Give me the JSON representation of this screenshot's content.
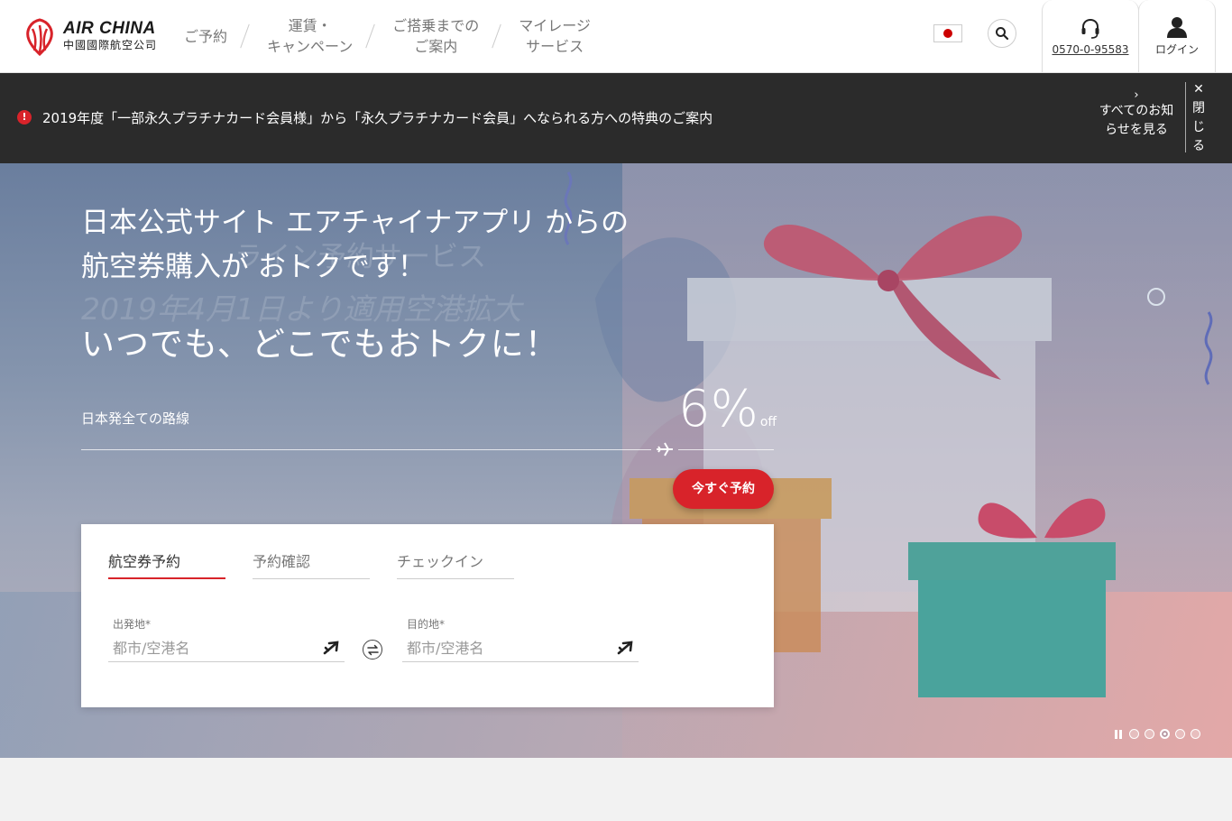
{
  "header": {
    "logo_en": "AIR CHINA",
    "logo_cn": "中國國際航空公司",
    "nav": [
      {
        "line1": "ご予約",
        "line2": ""
      },
      {
        "line1": "運賃・",
        "line2": "キャンペーン"
      },
      {
        "line1": "ご搭乗までの",
        "line2": "ご案内"
      },
      {
        "line1": "マイレージ",
        "line2": "サービス"
      }
    ],
    "phone": "0570-0-95583",
    "login": "ログイン"
  },
  "notice": {
    "alert_glyph": "!",
    "text": "2019年度「一部永久プラチナカード会員様」から「永久プラチナカード会員」へなられる方への特典のご案内",
    "view_all_line1": "すべてのお知",
    "view_all_line2": "らせを見る",
    "view_all_chevron": "›",
    "close_x": "✕",
    "close_chars": [
      "閉",
      "じ",
      "る"
    ]
  },
  "hero": {
    "headline_line1": "日本公式サイト エアチャイナアプリ からの",
    "headline_line2": "航空券購入が おトクです！",
    "ghost_line1": "ライン予約サービス",
    "ghost_line2": "2019年4月1日より適用空港拡大",
    "subheadline": "いつでも、どこでもおトクに！",
    "route_label": "日本発全ての路線",
    "discount_value": "6%",
    "discount_suffix": "off",
    "book_button": "今すぐ予約",
    "slides_total": 5,
    "slide_active": 3
  },
  "booking": {
    "tabs": [
      "航空券予約",
      "予約確認",
      "チェックイン"
    ],
    "active_tab": 0,
    "origin_label": "出発地*",
    "origin_placeholder": "都市/空港名",
    "destination_label": "目的地*",
    "destination_placeholder": "都市/空港名"
  },
  "colors": {
    "brand_red": "#d8232a",
    "notice_bg": "#2b2b2b"
  },
  "icons": [
    "air-china-logo-icon",
    "japan-flag-icon",
    "search-icon",
    "headset-icon",
    "user-icon",
    "alert-icon",
    "chevron-right-icon",
    "close-icon",
    "plane-icon",
    "swap-icon",
    "pause-icon"
  ]
}
